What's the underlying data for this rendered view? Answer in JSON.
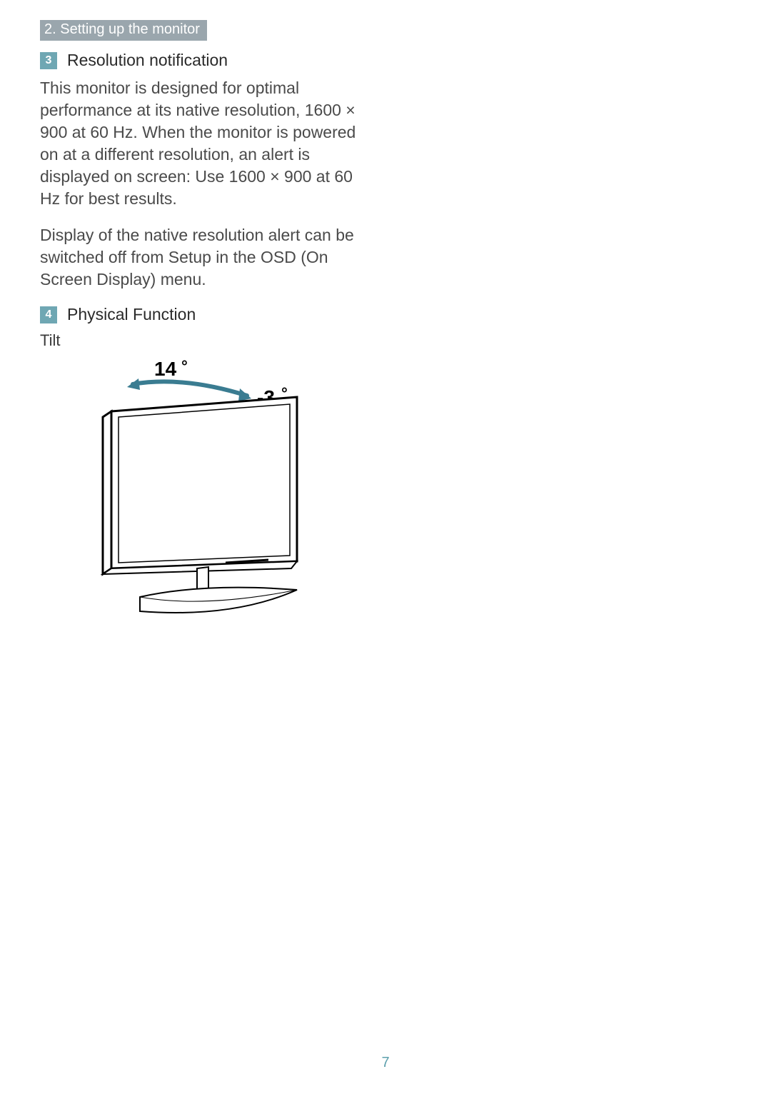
{
  "header": {
    "section_title": "2. Setting up the monitor"
  },
  "sections": [
    {
      "badge": "3",
      "title": "Resolution notification",
      "paragraphs": [
        "This monitor is designed for optimal performance at its native resolution, 1600 × 900 at 60 Hz. When the monitor is powered on at a different resolution, an alert is displayed on screen: Use 1600 × 900 at 60 Hz for best results.",
        "Display of the native resolution alert can be switched off from Setup in the OSD (On Screen Display) menu."
      ]
    },
    {
      "badge": "4",
      "title": "Physical Function",
      "subhead": "Tilt",
      "tilt": {
        "back": "14",
        "forward": "-3"
      }
    }
  ],
  "page_number": "7"
}
